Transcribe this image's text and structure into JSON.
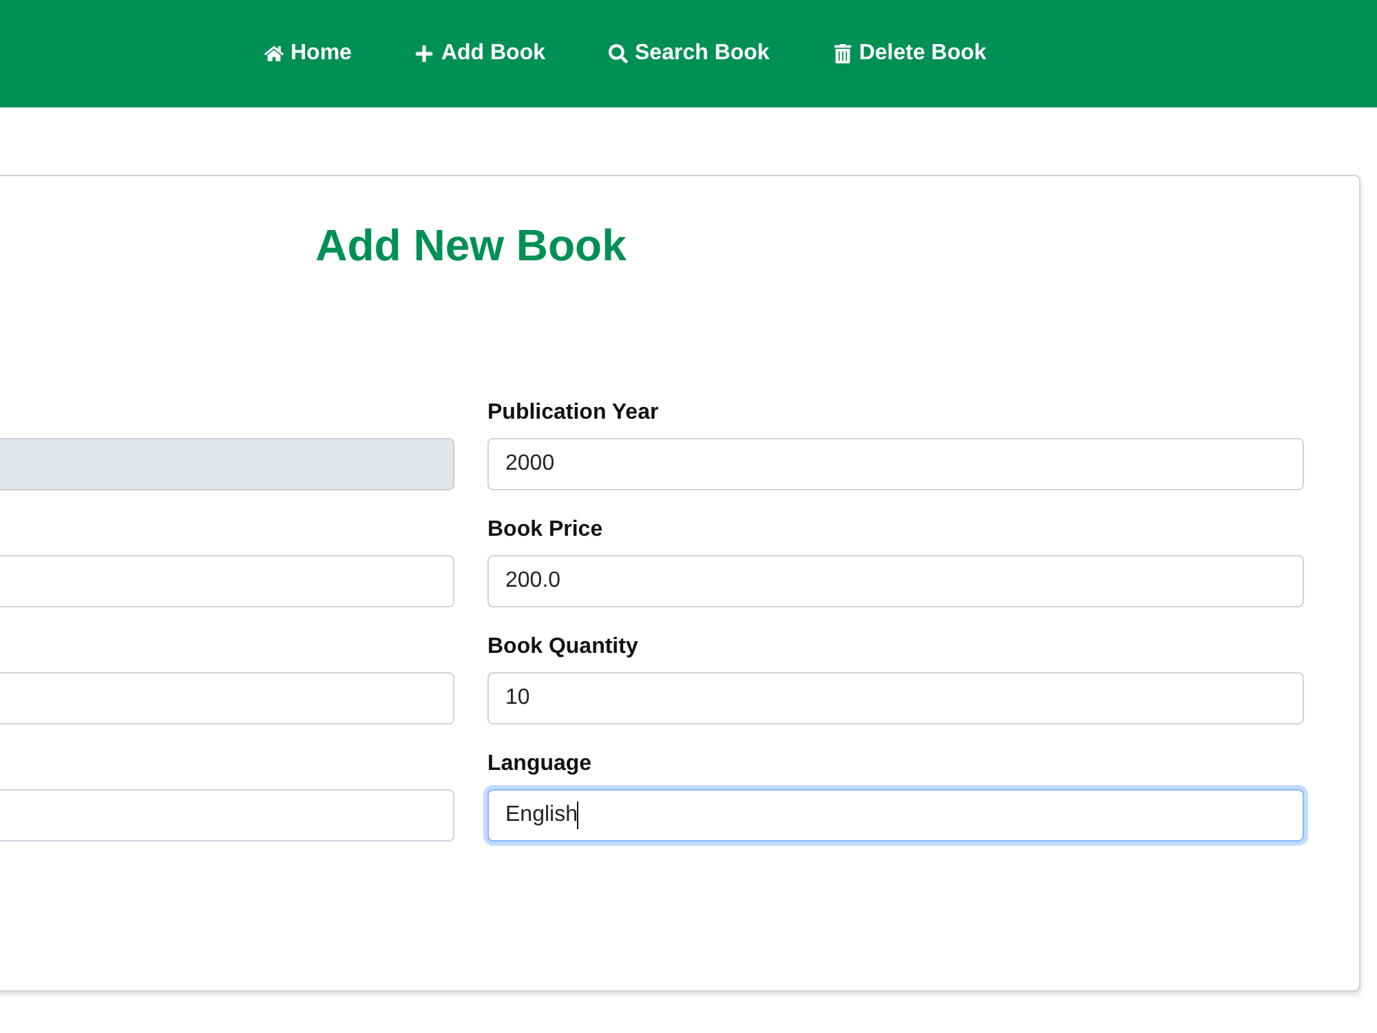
{
  "navbar": {
    "items": [
      {
        "label": "Home"
      },
      {
        "label": "Add Book"
      },
      {
        "label": "Search Book"
      },
      {
        "label": "Delete Book"
      }
    ]
  },
  "form": {
    "title": "Add New Book",
    "left_column": [
      {
        "disabled": true
      },
      {
        "disabled": false
      },
      {
        "disabled": false
      },
      {
        "disabled": false
      }
    ],
    "right_column": [
      {
        "label": "Publication Year",
        "value": "2000",
        "focused": false
      },
      {
        "label": "Book Price",
        "value": "200.0",
        "focused": false
      },
      {
        "label": "Book Quantity",
        "value": "10",
        "focused": false
      },
      {
        "label": "Language",
        "value": "English",
        "focused": true
      }
    ]
  }
}
